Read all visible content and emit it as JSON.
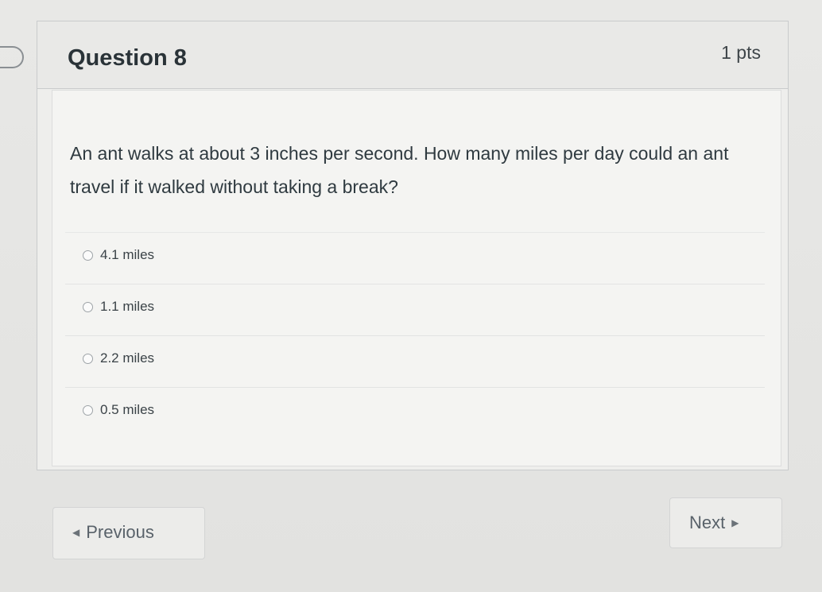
{
  "question": {
    "title": "Question 8",
    "points": "1 pts",
    "text": "An ant walks at about 3 inches per second. How many miles per day could an ant travel if it walked without taking a break?",
    "answers": [
      {
        "label": "4.1 miles",
        "selected": false
      },
      {
        "label": "1.1 miles",
        "selected": false
      },
      {
        "label": "2.2 miles",
        "selected": false
      },
      {
        "label": "0.5 miles",
        "selected": false
      }
    ]
  },
  "navigation": {
    "previous_label": "Previous",
    "next_label": "Next",
    "previous_icon": "left-arrow-icon",
    "next_icon": "right-arrow-icon"
  }
}
